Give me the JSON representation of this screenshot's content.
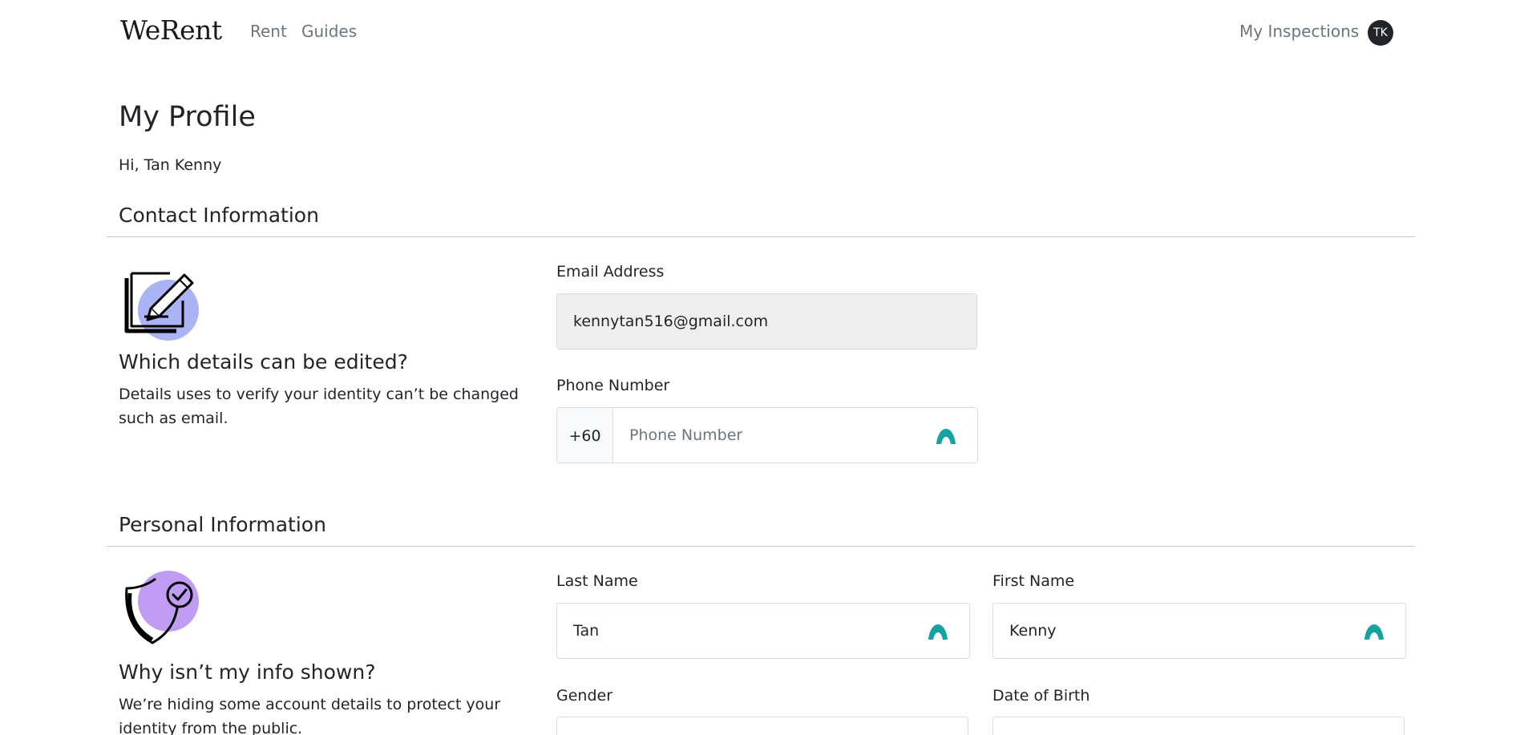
{
  "nav": {
    "brand": "WeRent",
    "links": [
      {
        "label": "Rent"
      },
      {
        "label": "Guides"
      }
    ],
    "inspections": "My Inspections",
    "avatar_initials": "TK"
  },
  "profile": {
    "title": "My Profile",
    "greeting": "Hi, Tan Kenny"
  },
  "contact": {
    "section_title": "Contact Information",
    "illustration_icon": "edit-document-icon",
    "info_title": "Which details can be edited?",
    "info_text": "Details uses to verify your identity can’t be changed such as email.",
    "email_label": "Email Address",
    "email_value": "kennytan516@gmail.com",
    "phone_label": "Phone Number",
    "phone_prefix": "+60",
    "phone_placeholder": "Phone Number",
    "phone_value": ""
  },
  "personal": {
    "section_title": "Personal Information",
    "illustration_icon": "shield-check-icon",
    "info_title": "Why isn’t my info shown?",
    "info_text": "We’re hiding some account details to protect your identity from the public.",
    "last_name_label": "Last Name",
    "last_name_value": "Tan",
    "first_name_label": "First Name",
    "first_name_value": "Kenny",
    "gender_label": "Gender",
    "dob_label": "Date of Birth"
  },
  "colors": {
    "accent_teal": "#17a2a2",
    "illus_blue": "#aab4f5",
    "illus_purple": "#c09cf5",
    "avatar_bg": "#212529"
  }
}
